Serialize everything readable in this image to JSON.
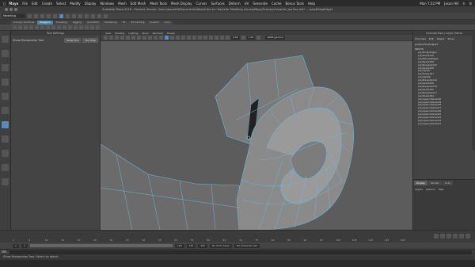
{
  "mac_menubar": {
    "app": "Maya",
    "items": [
      "File",
      "Edit",
      "Create",
      "Select",
      "Modify",
      "Display",
      "Windows",
      "Mesh",
      "Edit Mesh",
      "Mesh Tools",
      "Mesh Display",
      "Curves",
      "Surfaces",
      "Deform",
      "UV",
      "Generate",
      "Cache",
      "Bonus Tools",
      "Help"
    ],
    "clock": "Mon 7:22 PM",
    "user": "Jason Hill"
  },
  "window": {
    "title": "Autodesk Maya 2016 - Student Version: /Users/jasonhill/Documents/Work/Intro to Character Modeling Course/Maya/Scenes/character_earGeo.mb* --- polyBridgeEdge1"
  },
  "status_line": {
    "mode": "Modeling"
  },
  "shelf_tabs": [
    "Curves / Surfaces",
    "Polygons",
    "Sculpting",
    "Rigging",
    "Animation",
    "Rendering",
    "FX",
    "FX Caching",
    "Custom",
    "Arno"
  ],
  "shelf_active_tab": "Polygons",
  "tool_settings": {
    "header": "Tool Settings",
    "tool_name": "Show Manipulator Tool",
    "reset_label": "Reset Tool",
    "help_label": "Tool Help"
  },
  "viewport": {
    "menus": [
      "View",
      "Shading",
      "Lighting",
      "Show",
      "Renderer",
      "Panels"
    ],
    "num1": "0.00",
    "num2": "1.00",
    "colorspace": "sRGB gamma"
  },
  "channel_box": {
    "header": "Channel Box / Layer Editor",
    "menus": [
      "Channels",
      "Edit",
      "Object",
      "Show"
    ],
    "object": "polySurfaceShape1",
    "inputs_label": "INPUTS",
    "history": [
      "polyBridgeEdge1",
      "polyTweak190",
      "polyExtrudeEdge5",
      "polyTweak189",
      "polyMergeVert20",
      "polyTweak188",
      "polySplit47",
      "polyTweak187",
      "polySplit46",
      "polyMergeVert19",
      "polyTweak186",
      "polyMergeVert18",
      "polyTweak185",
      "polyMergeVert17",
      "polyTweak184",
      "polyAppendVertex50",
      "polyAppendVertex49",
      "polyAppendVertex48",
      "polyAppendVertex47",
      "polyAppendVertex46",
      "polyAppendVertex45",
      "polyAppendVertex44",
      "polyAppendVertex43",
      "polyAppendVertex42"
    ]
  },
  "layer_editor": {
    "tabs": [
      "Display",
      "Render",
      "Anim"
    ],
    "menus": [
      "Layers",
      "Options",
      "Help"
    ]
  },
  "time_slider": {
    "ticks": [
      "1",
      "5",
      "10",
      "15",
      "20",
      "25",
      "30",
      "35",
      "40",
      "45",
      "50",
      "55",
      "60",
      "65",
      "70",
      "75",
      "80",
      "85",
      "90",
      "95",
      "100",
      "105",
      "110",
      "115",
      "120"
    ],
    "current": "1"
  },
  "range_slider": {
    "start": "1",
    "inner_start": "1",
    "inner_end": "120",
    "end": "120",
    "end2": "200",
    "anim_layer": "No Anim Layer",
    "char_set": "No Character Set"
  },
  "command_line": {
    "label": "MEL"
  },
  "help_line": {
    "text": "Show Manipulator Tool: Select an object"
  }
}
